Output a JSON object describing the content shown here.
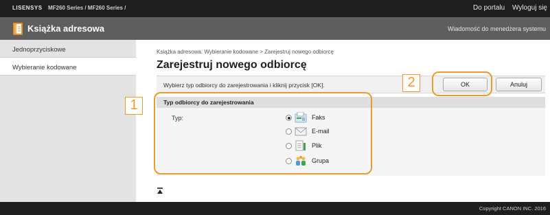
{
  "topbar": {
    "brand": "LISENSYS",
    "device": "MF260 Series / MF260 Series /",
    "portal_link": "Do portalu",
    "logout_link": "Wyloguj się"
  },
  "appbar": {
    "title": "Książka adresowa",
    "message_link": "Wiadomość do menedżera systemu"
  },
  "sidebar": {
    "items": [
      {
        "label": "Jednoprzyciskowe"
      },
      {
        "label": "Wybieranie kodowane"
      }
    ],
    "selected_index": 1
  },
  "main": {
    "breadcrumb": "Książka adresowa: Wybieranie kodowane > Zarejestruj nowego odbiorcę",
    "title": "Zarejestruj nowego odbiorcę",
    "instruction": "Wybierz typ odbiorcy do zarejestrowania i kliknij przycisk [OK].",
    "ok_label": "OK",
    "cancel_label": "Anuluj",
    "section": {
      "title": "Typ odbiorcy do zarejestrowania",
      "type_label": "Typ:",
      "options": [
        {
          "label": "Faks",
          "icon": "fax-icon",
          "selected": true
        },
        {
          "label": "E-mail",
          "icon": "email-icon",
          "selected": false
        },
        {
          "label": "Plik",
          "icon": "file-icon",
          "selected": false
        },
        {
          "label": "Grupa",
          "icon": "group-icon",
          "selected": false
        }
      ]
    }
  },
  "callouts": {
    "one": "1",
    "two": "2"
  },
  "footer": {
    "copyright": "Copyright CANON INC. 2016"
  },
  "colors": {
    "accent": "#ee9a2a",
    "topbar": "#1e1e1e",
    "appbar": "#5e5e5e",
    "sidebar": "#e3e3e3"
  }
}
